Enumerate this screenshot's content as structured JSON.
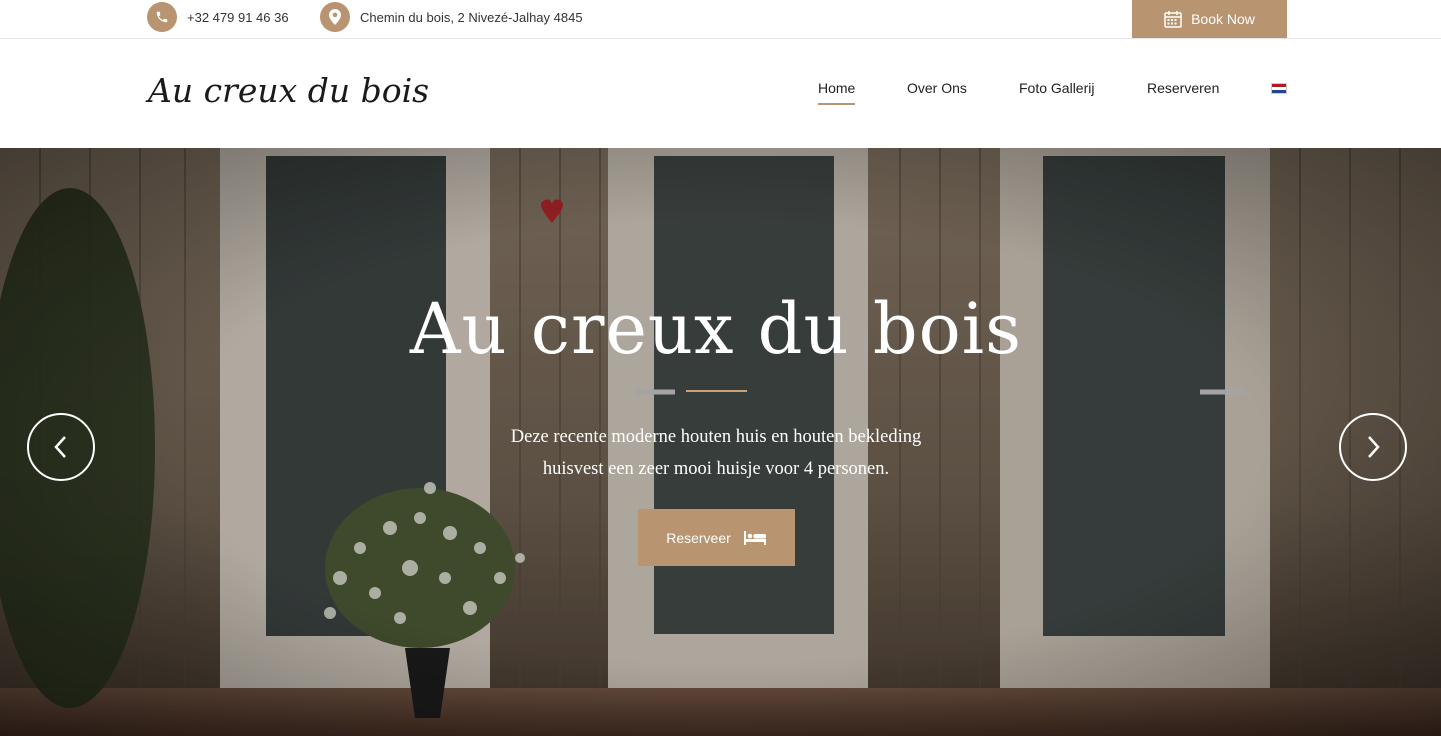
{
  "topbar": {
    "phone": "+32 479 91 46 36",
    "address": "Chemin du bois, 2 Nivezé-Jalhay 4845",
    "book_label": "Book Now"
  },
  "header": {
    "logo": "Au creux du bois",
    "nav": [
      {
        "label": "Home",
        "active": true
      },
      {
        "label": "Over Ons",
        "active": false
      },
      {
        "label": "Foto Gallerij",
        "active": false
      },
      {
        "label": "Reserveren",
        "active": false
      }
    ],
    "language_flag": "dutch-flag-icon"
  },
  "hero": {
    "title": "Au creux du bois",
    "description_line1": "Deze recente moderne houten huis en houten bekleding",
    "description_line2": "huisvest een zeer mooi huisje voor 4 personen.",
    "button_label": "Reserveer",
    "button_icon": "bed-icon"
  },
  "colors": {
    "accent": "#b89470",
    "text": "#222222"
  }
}
